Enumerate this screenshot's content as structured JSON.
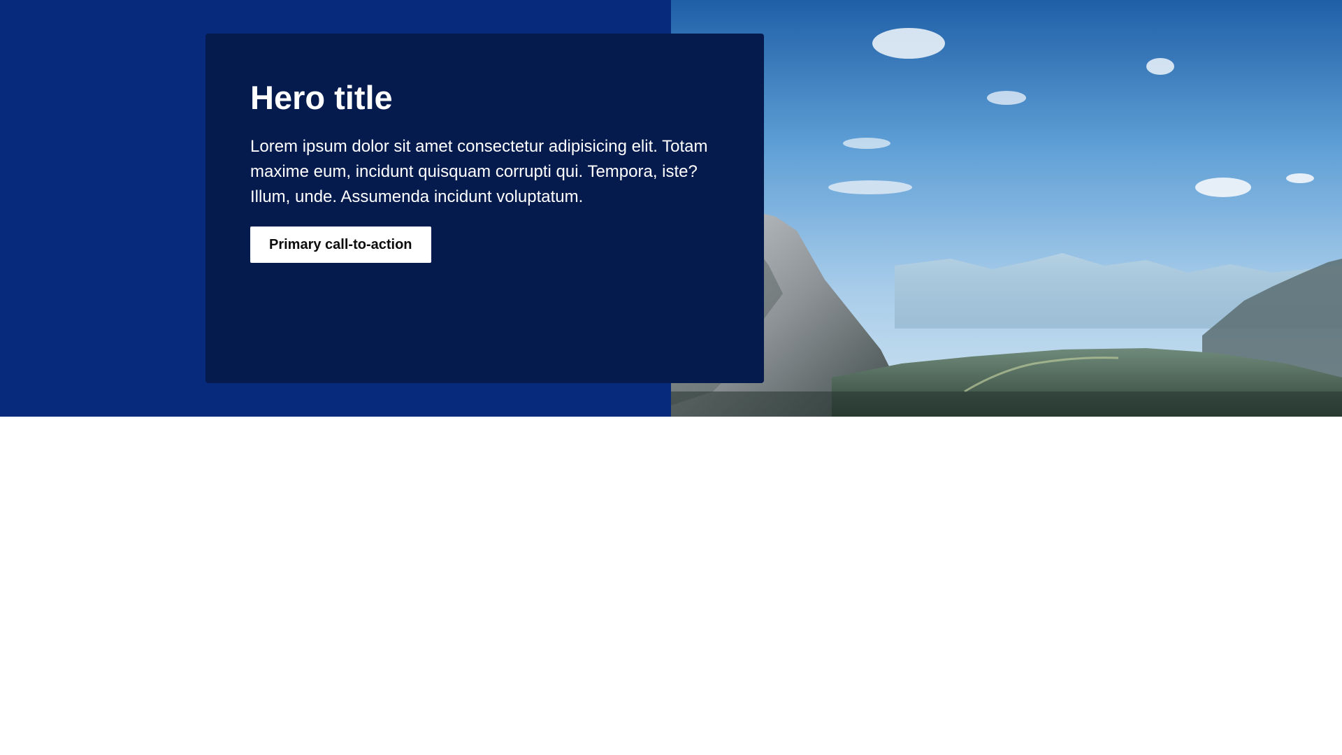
{
  "hero": {
    "title": "Hero title",
    "body": "Lorem ipsum dolor sit amet consectetur adipisicing elit. Totam maxime eum, incidunt quisquam corrupti qui. Tempora, iste? Illum, unde. Assumenda incidunt voluptatum.",
    "cta_label": "Primary call-to-action",
    "image": "mountain-landscape-photo"
  },
  "colors": {
    "left_background": "#072a7d",
    "card_background": "#051b4e",
    "button_background": "#ffffff",
    "button_text": "#0b0b0b",
    "page_background": "#ffffff"
  }
}
